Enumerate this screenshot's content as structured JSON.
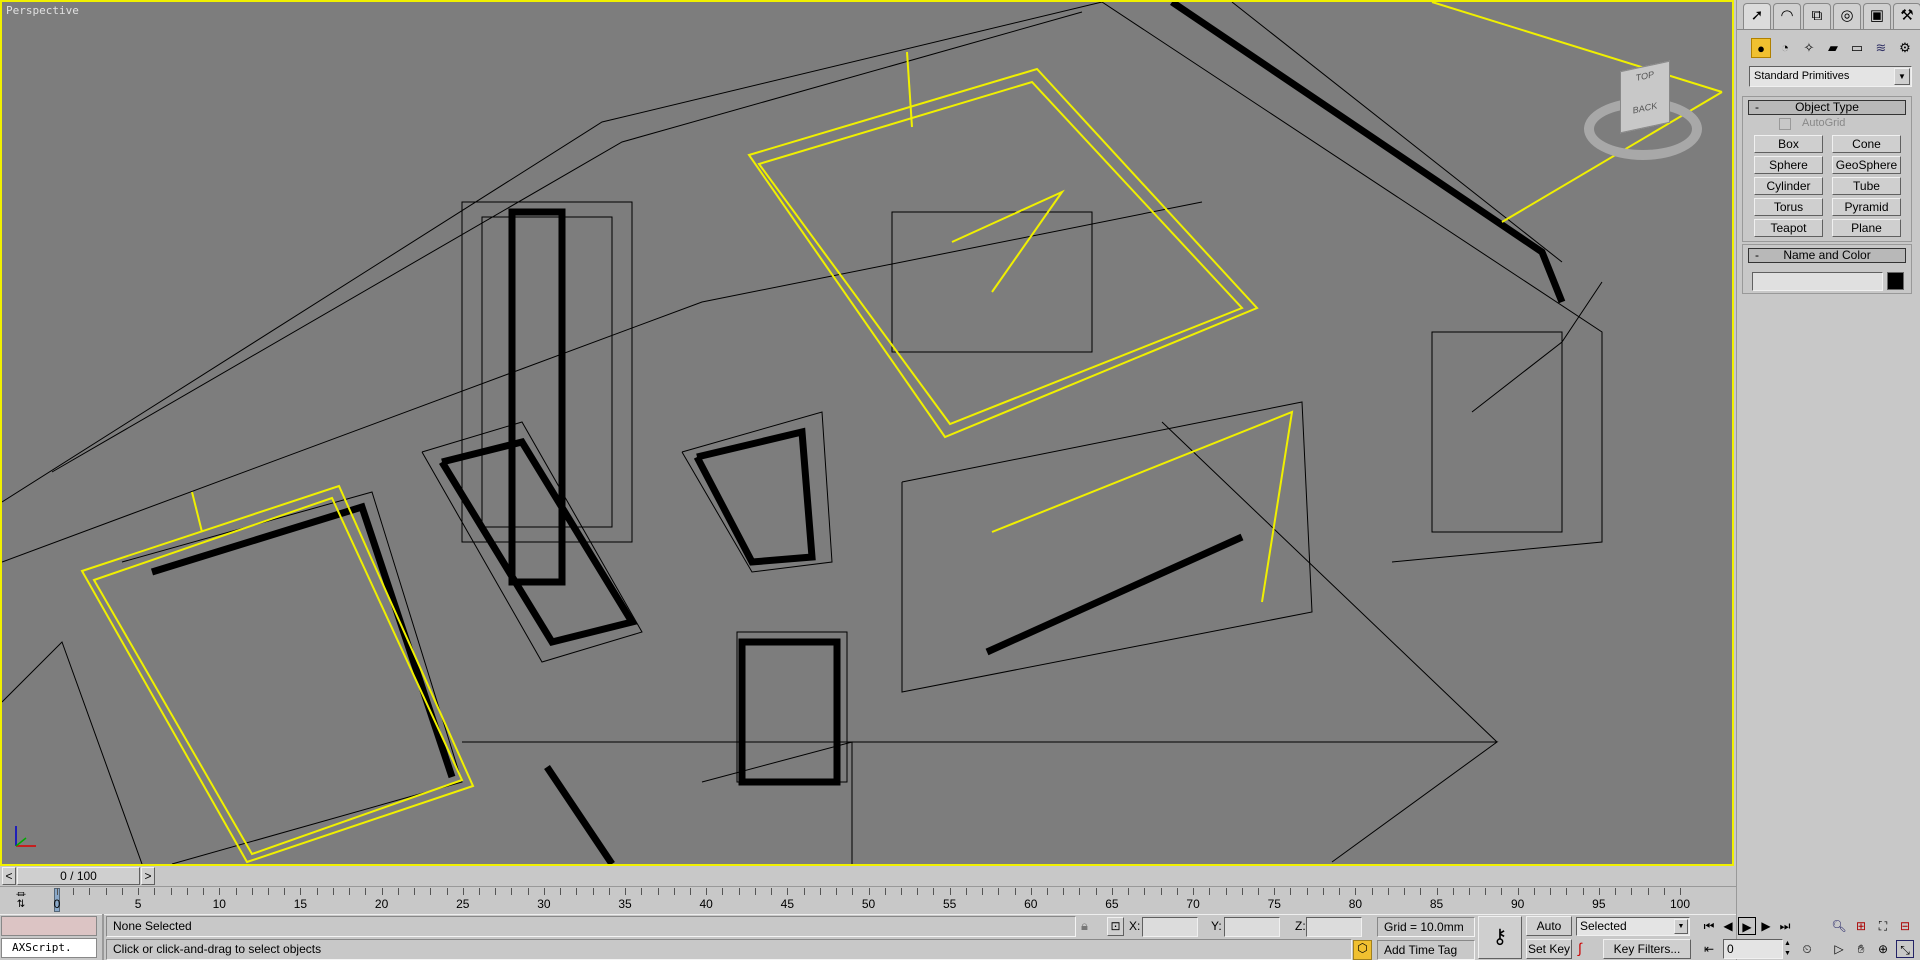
{
  "viewport": {
    "label": "Perspective",
    "border_color": "#f0f000",
    "background": "#7d7d7d",
    "viewcube": {
      "top_label": "TOP",
      "face_label": "BACK"
    }
  },
  "command_panel": {
    "tabs": [
      {
        "icon": "create-icon"
      },
      {
        "icon": "modify-icon"
      },
      {
        "icon": "hierarchy-icon"
      },
      {
        "icon": "motion-icon"
      },
      {
        "icon": "display-icon"
      },
      {
        "icon": "utilities-icon"
      }
    ],
    "categories": [
      {
        "icon": "geometry-icon"
      },
      {
        "icon": "shapes-icon"
      },
      {
        "icon": "lights-icon"
      },
      {
        "icon": "cameras-icon"
      },
      {
        "icon": "helpers-icon"
      },
      {
        "icon": "space-warps-icon"
      },
      {
        "icon": "systems-icon"
      }
    ],
    "dropdown_value": "Standard Primitives",
    "object_type": {
      "title": "Object Type",
      "collapse": "-",
      "autogrid": "AutoGrid",
      "buttons": [
        "Box",
        "Cone",
        "Sphere",
        "GeoSphere",
        "Cylinder",
        "Tube",
        "Torus",
        "Pyramid",
        "Teapot",
        "Plane"
      ]
    },
    "name_and_color": {
      "title": "Name and Color",
      "collapse": "-",
      "name_value": "",
      "color": "#000000"
    }
  },
  "time_slider": {
    "prev": "<",
    "value": "0 / 100",
    "next": ">",
    "current": 0,
    "max": 100
  },
  "ruler": {
    "labels": [
      "0",
      "5",
      "10",
      "15",
      "20",
      "25",
      "30",
      "35",
      "40",
      "45",
      "50",
      "55",
      "60",
      "65",
      "70",
      "75",
      "80",
      "85",
      "90",
      "95",
      "100"
    ]
  },
  "status": {
    "maxscript": "AXScript.",
    "selection": "None Selected",
    "prompt": "Click or click-and-drag to select objects",
    "x_label": "X:",
    "y_label": "Y:",
    "z_label": "Z:",
    "x_value": "",
    "y_value": "",
    "z_value": "",
    "grid": "Grid = 10.0mm",
    "add_time_tag": "Add Time Tag",
    "auto_key": "Auto Key",
    "set_key": "Set Key",
    "key_mode": "Selected",
    "key_filters": "Key Filters...",
    "frame": "0"
  }
}
